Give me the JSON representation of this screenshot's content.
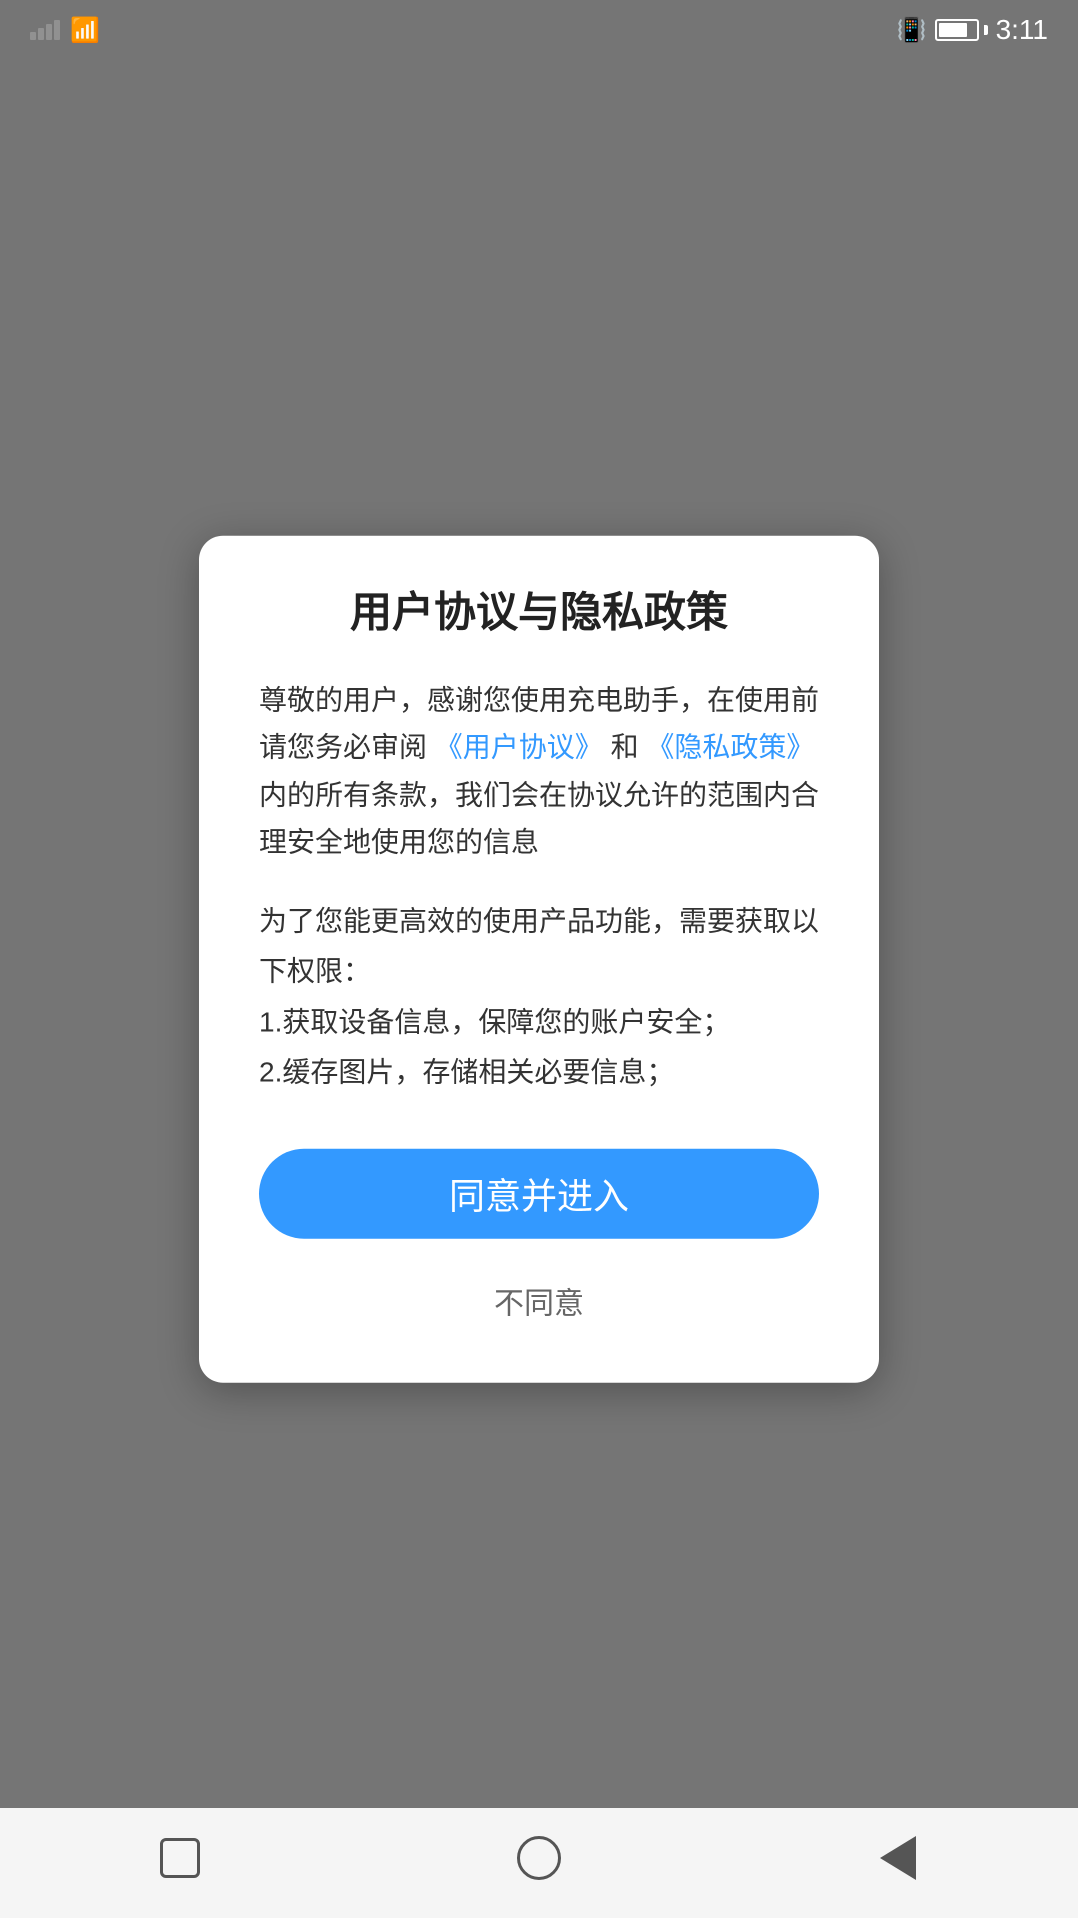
{
  "statusBar": {
    "time": "3:11",
    "bluetooth": "⚡",
    "batteryLevel": 80
  },
  "dialog": {
    "title": "用户协议与隐私政策",
    "bodyPart1": "尊敬的用户，感谢您使用充电助手，在使用前请您务必审阅",
    "userAgreementLink": "《用户协议》",
    "bodyPart2": "和",
    "privacyPolicyLink": "《隐私政策》",
    "bodyPart3": "内的所有条款，我们会在协议允许的范围内合理安全地使用您的信息",
    "permissionsIntro": "为了您能更高效的使用产品功能，需要获取以下权限：",
    "permission1": "1.获取设备信息，保障您的账户安全；",
    "permission2": "2.缓存图片，存储相关必要信息；",
    "agreeButtonLabel": "同意并进入",
    "disagreeButtonLabel": "不同意"
  },
  "navBar": {
    "backLabel": "back",
    "homeLabel": "home",
    "recentLabel": "recent"
  }
}
